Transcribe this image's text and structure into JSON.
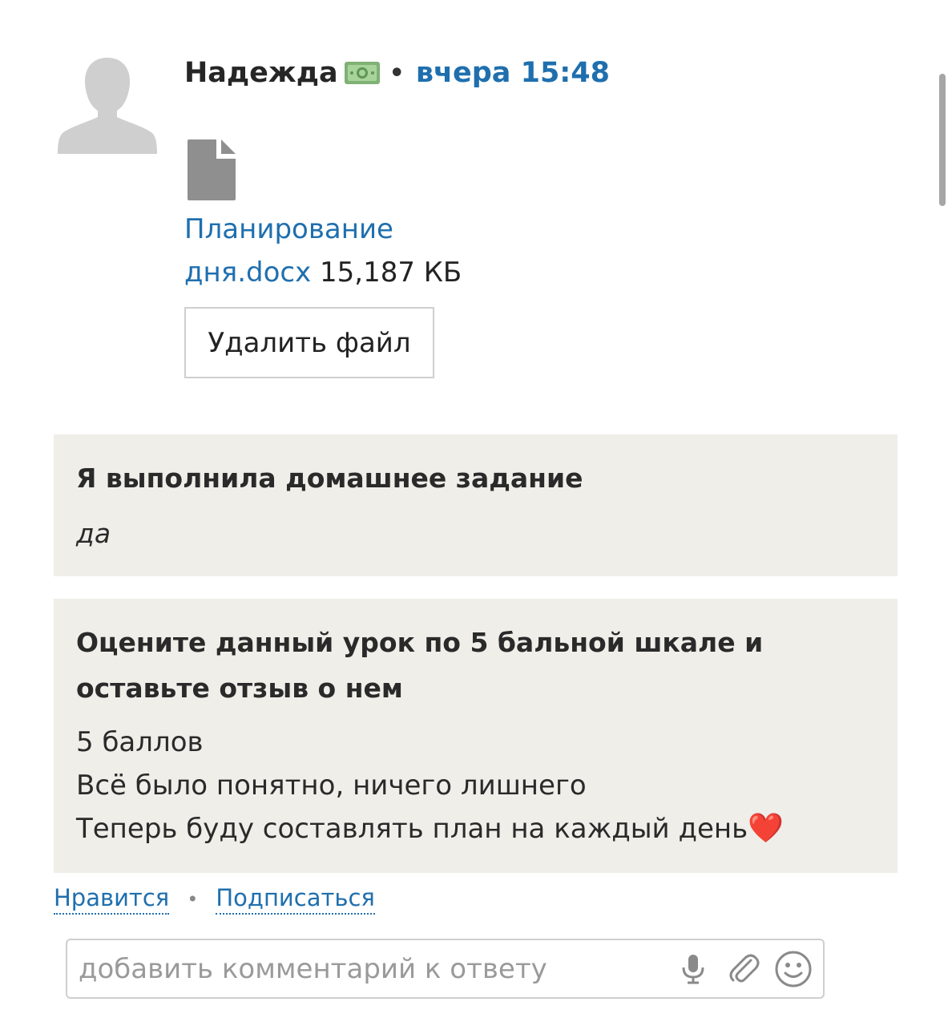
{
  "post": {
    "author": "Надежда",
    "author_badge_icon": "money-icon",
    "separator": "•",
    "time": "вчера 15:48"
  },
  "attachment": {
    "icon": "file-icon",
    "name_line1": "Планирование",
    "name_line2": "дня.docx",
    "size": "15,187 КБ",
    "delete_label": "Удалить файл"
  },
  "answers": [
    {
      "question": "Я выполнила домашнее задание",
      "answer": "да"
    },
    {
      "question": "Оцените данный урок по 5 бальной шкале и оставьте отзыв о нем",
      "lines": [
        "5 баллов",
        "Всё было понятно, ничего лишнего",
        "Теперь буду составлять план на каждый день"
      ],
      "emoji": "❤️"
    }
  ],
  "actions": {
    "like_label": "Нравится",
    "separator": "•",
    "subscribe_label": "Подписаться"
  },
  "comment": {
    "placeholder": "добавить комментарий к ответу",
    "value": "",
    "icons": [
      "microphone-icon",
      "paperclip-icon",
      "emoji-icon"
    ]
  },
  "colors": {
    "link": "#1f6fae",
    "card_background": "#efeee9",
    "heart": "#e4141e"
  }
}
